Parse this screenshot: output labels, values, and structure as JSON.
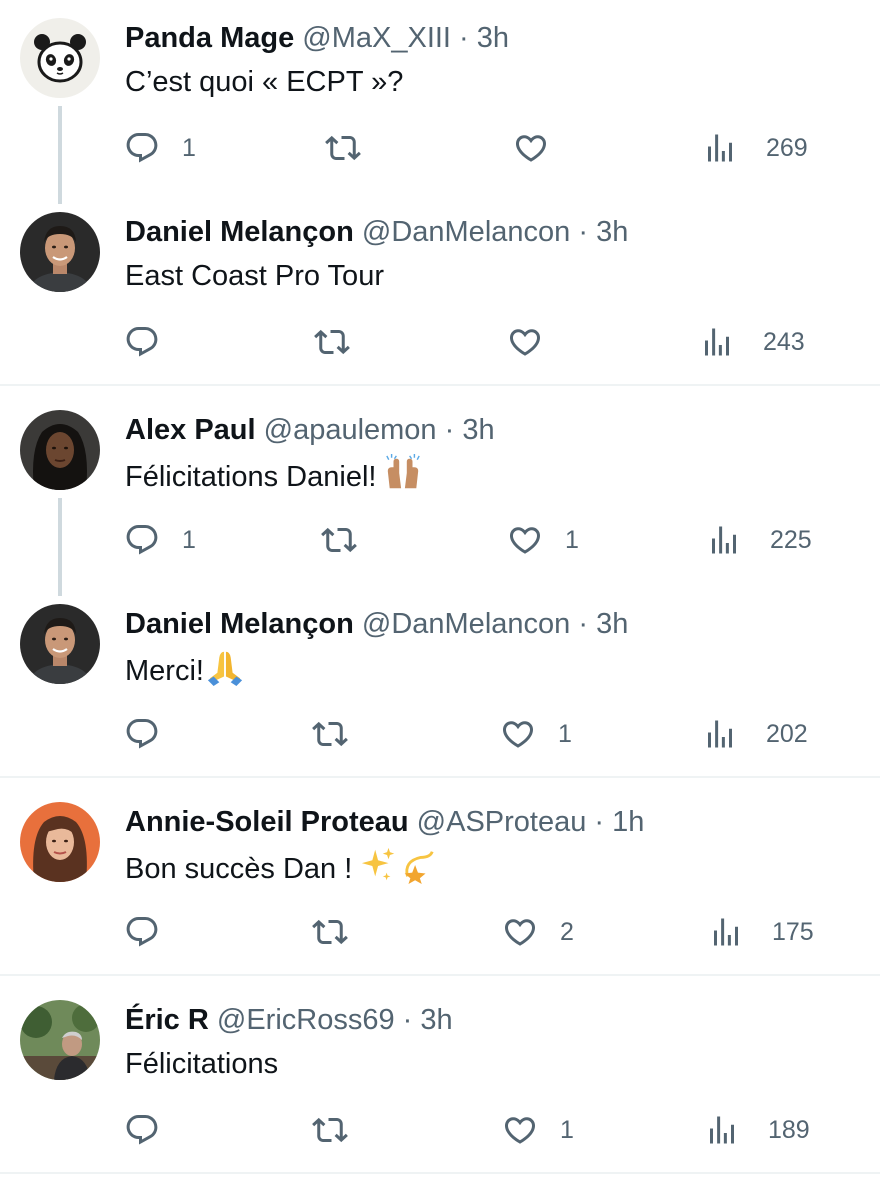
{
  "tweets": [
    {
      "name": "Panda Mage",
      "handle": "@MaX_XIII",
      "time": "3h",
      "text": "C’est quoi « ECPT »?",
      "avatar_icon": "panda-avatar",
      "replies": "1",
      "retweets": "",
      "likes": "",
      "views": "269"
    },
    {
      "name": "Daniel Melançon",
      "handle": "@DanMelancon",
      "time": "3h",
      "text": "East Coast Pro Tour",
      "avatar_icon": "man-portrait-avatar",
      "replies": "",
      "retweets": "",
      "likes": "",
      "views": "243"
    },
    {
      "name": "Alex Paul",
      "handle": "@apaulemon",
      "time": "3h",
      "text": "Félicitations Daniel!",
      "emoji": "raising-hands-emoji",
      "avatar_icon": "woman-portrait-avatar",
      "replies": "1",
      "retweets": "",
      "likes": "1",
      "views": "225"
    },
    {
      "name": "Daniel Melançon",
      "handle": "@DanMelancon",
      "time": "3h",
      "text": "Merci!",
      "emoji": "folded-hands-emoji",
      "avatar_icon": "man-portrait-avatar",
      "replies": "",
      "retweets": "",
      "likes": "1",
      "views": "202"
    },
    {
      "name": "Annie-Soleil Proteau",
      "handle": "@ASProteau",
      "time": "1h",
      "text": "Bon succès Dan !",
      "emoji": "sparkles-dizzy-emoji",
      "avatar_icon": "woman-portrait-avatar",
      "replies": "",
      "retweets": "",
      "likes": "2",
      "views": "175"
    },
    {
      "name": "Éric R",
      "handle": "@EricRoss69",
      "time": "3h",
      "text": "Félicitations",
      "avatar_icon": "outdoor-portrait-avatar",
      "replies": "",
      "retweets": "",
      "likes": "1",
      "views": "189"
    }
  ],
  "colors": {
    "text": "#0f1419",
    "secondary": "#536471",
    "thread": "#cfd9de",
    "divider": "#eff3f4"
  }
}
